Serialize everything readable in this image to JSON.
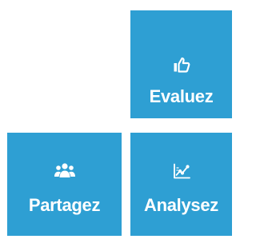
{
  "tiles": {
    "evaluez": {
      "label": "Evaluez",
      "icon": "thumbs-up-icon"
    },
    "partagez": {
      "label": "Partagez",
      "icon": "users-group-icon"
    },
    "analysez": {
      "label": "Analysez",
      "icon": "line-chart-icon"
    }
  },
  "colors": {
    "tile_background": "#2e9fd3",
    "tile_text": "#ffffff",
    "page_background": "#ffffff"
  }
}
